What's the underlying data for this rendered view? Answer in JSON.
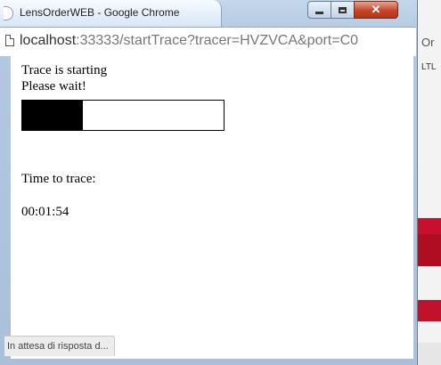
{
  "window": {
    "title": "LensOrderWEB - Google Chrome"
  },
  "address": {
    "host": "localhost",
    "path": ":33333/startTrace?tracer=HVZVCA&port=C0"
  },
  "page": {
    "line1": "Trace is starting",
    "line2": "Please wait!",
    "progress_fraction": 0.3,
    "time_label": "Time to trace:",
    "time_value": "00:01:54"
  },
  "status_bar": {
    "text": "In attesa di risposta d..."
  },
  "background_app": {
    "label1": "Or",
    "label2": "LTL"
  },
  "colors": {
    "progress": "#000000",
    "close_button": "#c7462a"
  }
}
